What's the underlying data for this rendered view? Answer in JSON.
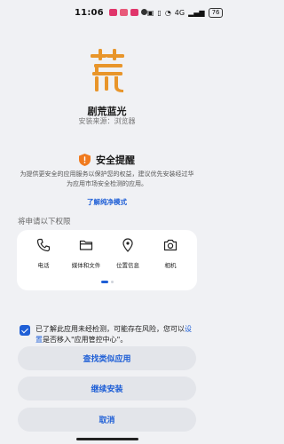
{
  "status_bar": {
    "time": "11:06",
    "network": "4G",
    "battery": "76"
  },
  "app": {
    "name": "剧荒蓝光",
    "source": "安装来源：浏览器",
    "logo_color": "#e8952a"
  },
  "security": {
    "title": "安全提醒",
    "description": "为提供更安全的应用服务以保护您的权益，建议优先安装经过华为应用市场安全检测的应用。",
    "learn_more": "了解纯净模式",
    "warning_color": "#f07a1e"
  },
  "permissions": {
    "heading": "将申请以下权限",
    "items": [
      {
        "label": "电话",
        "icon": "phone-icon"
      },
      {
        "label": "媒体和文件",
        "icon": "folder-icon"
      },
      {
        "label": "位置信息",
        "icon": "location-icon"
      },
      {
        "label": "相机",
        "icon": "camera-icon"
      }
    ]
  },
  "consent": {
    "checked": true,
    "text_before": "已了解此应用未经检测，可能存在风险，您可以",
    "link": "设置",
    "text_after": "是否移入\"应用管控中心\"。"
  },
  "buttons": {
    "find_similar": "查找类似应用",
    "continue_install": "继续安装",
    "cancel": "取消"
  },
  "accent_color": "#1f5fd6"
}
